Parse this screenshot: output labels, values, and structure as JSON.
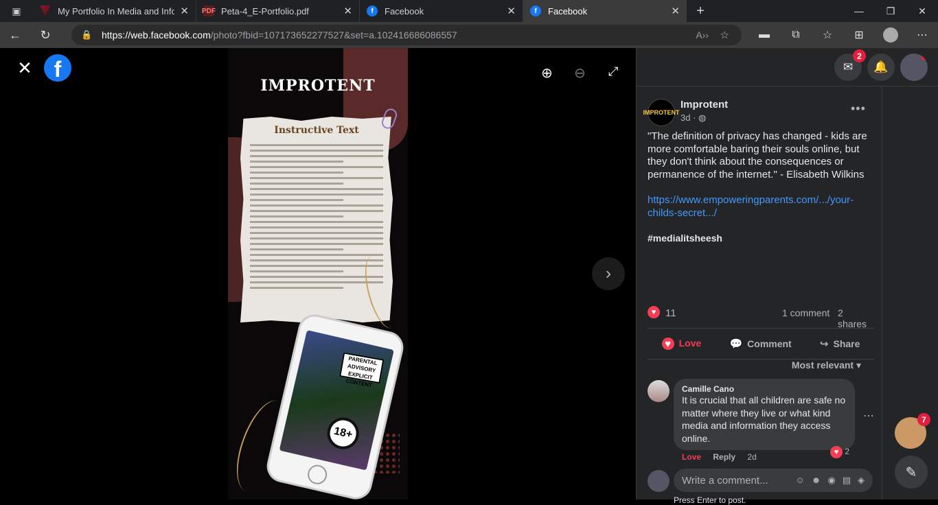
{
  "browser": {
    "tabs": [
      {
        "title": "My Portfolio In Media and Inform",
        "icon": "portfolio-favicon"
      },
      {
        "title": "Peta-4_E-Portfolio.pdf",
        "icon": "pdf-favicon"
      },
      {
        "title": "Facebook",
        "icon": "facebook-favicon"
      },
      {
        "title": "Facebook",
        "icon": "facebook-favicon",
        "active": true
      }
    ],
    "url_host": "https://web.facebook.com",
    "url_path": "/photo?fbid=107173652277527&set=a.102416686086557"
  },
  "poster": {
    "title": "IMPROTENT",
    "heading": "Instructive Text",
    "advisory": "PARENTAL ADVISORY EXPLICIT CONTENT",
    "age": "18+"
  },
  "header": {
    "messenger_badge": "2",
    "floating_badge": "7"
  },
  "post": {
    "page_name": "Improtent",
    "page_avatar_text": "IMPROTENT",
    "meta": "3d · ◍",
    "text": "\"The definition of privacy has changed - kids are more comfortable baring their souls online, but they don't think about the consequences or permanence of the internet.\" - Elisabeth Wilkins",
    "link": "https://www.empoweringparents.com/.../your-childs-secret.../",
    "hashtag": "#medialitsheesh",
    "reactions": "11",
    "comments": "1 comment",
    "shares": "2 shares",
    "actions": {
      "love": "Love",
      "comment": "Comment",
      "share": "Share"
    },
    "sort": "Most relevant"
  },
  "comment": {
    "author": "Camille Cano",
    "text": "It is crucial that all children are safe no matter where they live or what kind media and information they access online.",
    "reactions": "2",
    "love": "Love",
    "reply": "Reply",
    "time": "2d"
  },
  "composer": {
    "placeholder": "Write a comment...",
    "hint": "Press Enter to post."
  },
  "colors": {
    "accent": "#1877f2",
    "love": "#f33e58",
    "link": "#4599ff"
  }
}
